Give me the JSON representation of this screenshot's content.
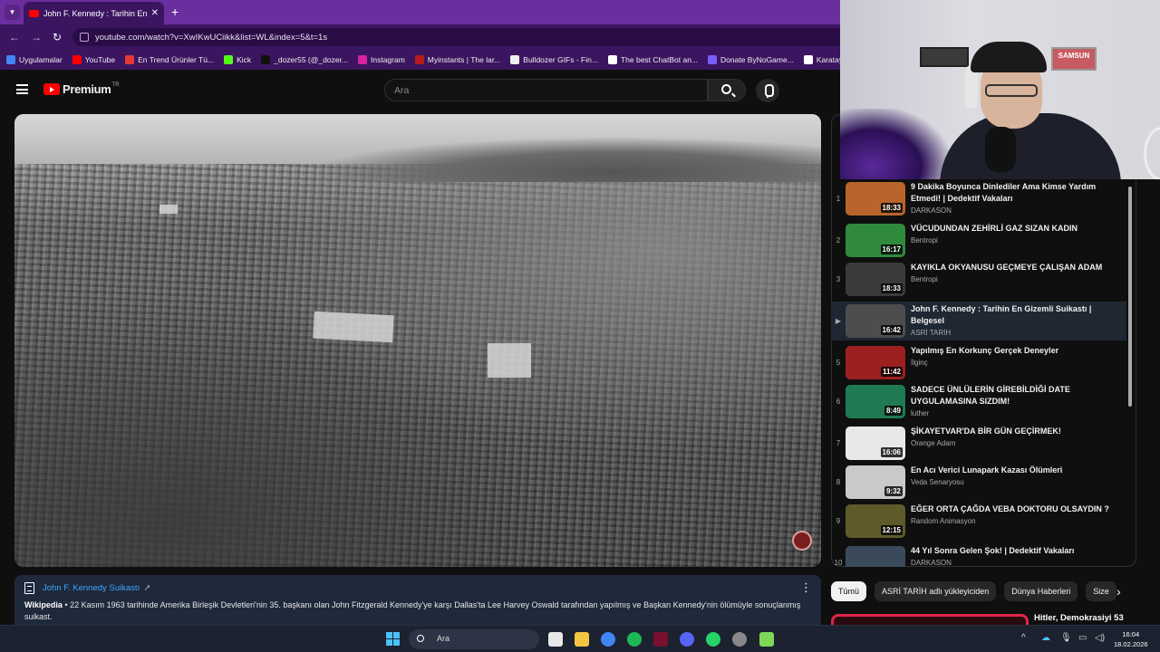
{
  "browser": {
    "tab_title": "John F. Kennedy : Tarihin En Gizemli",
    "tab_close": "✕",
    "new_tab": "+",
    "url": "youtube.com/watch?v=XwIKwUCiikk&list=WL&index=5&t=1s",
    "bookmarks": [
      {
        "label": "Uygulamalar",
        "color": "#4285f4"
      },
      {
        "label": "YouTube",
        "color": "#ff0000"
      },
      {
        "label": "En Trend Ürünler Tü...",
        "color": "#e53935"
      },
      {
        "label": "Kick",
        "color": "#53fc18"
      },
      {
        "label": "_dozer55 (@_dozer...",
        "color": "#111111"
      },
      {
        "label": "Instagram",
        "color": "#d6249f"
      },
      {
        "label": "Myinstants | The lar...",
        "color": "#b71c1c"
      },
      {
        "label": "Bulldozer GIFs - Fin...",
        "color": "#eeeeee"
      },
      {
        "label": "The best ChatBot an...",
        "color": "#ffffff"
      },
      {
        "label": "Donate ByNoGame...",
        "color": "#7b5cff"
      },
      {
        "label": "Karatay Belediyesi",
        "color": "#ffffff"
      }
    ]
  },
  "header": {
    "logo_text": "Premium",
    "region": "TR",
    "search_placeholder": "Ara"
  },
  "info_card": {
    "title": "John F. Kennedy Suikastı",
    "link_icon": "↗",
    "source": "Wikipedia",
    "text": " • 22 Kasım 1963 tarihinde Amerika Birleşik Devletleri'nin 35. başkanı olan John Fitzgerald Kennedy'ye karşı Dallas'ta Lee Harvey Oswald tarafından yapılmış ve Başkan Kennedy'nin ölümüyle sonuçlanmış suikast.",
    "more": "⋮"
  },
  "playlist": [
    {
      "index": "1",
      "title": "9 Dakika Boyunca Dinlediler Ama Kimse Yardım Etmedi! | Dedektif Vakaları",
      "channel": "DARKASON",
      "duration": "18:33",
      "thumb": "#b8642a"
    },
    {
      "index": "2",
      "title": "VÜCUDUNDAN ZEHİRLİ GAZ SIZAN KADIN",
      "channel": "Bentropi",
      "duration": "16:17",
      "thumb": "#2f8a3c"
    },
    {
      "index": "3",
      "title": "KAYIKLA OKYANUSU GEÇMEYE ÇALIŞAN ADAM",
      "channel": "Bentropi",
      "duration": "18:33",
      "thumb": "#3a3a3a"
    },
    {
      "index": "▶",
      "title": "John F. Kennedy : Tarihin En Gizemli Suikastı | Belgesel",
      "channel": "ASRİ TARİH",
      "duration": "16:42",
      "thumb": "#4d4d4d",
      "active": true
    },
    {
      "index": "5",
      "title": "Yapılmış En Korkunç Gerçek Deneyler",
      "channel": "İlginç",
      "duration": "11:42",
      "thumb": "#9c2020"
    },
    {
      "index": "6",
      "title": "SADECE ÜNLÜLERİN GİREBİLDİĞİ DATE UYGULAMASINA SIZDIM!",
      "channel": "luther",
      "duration": "8:49",
      "thumb": "#1f7a52"
    },
    {
      "index": "7",
      "title": "ŞİKAYETVAR'DA BİR GÜN GEÇİRMEK!",
      "channel": "Orange Adam",
      "duration": "16:06",
      "thumb": "#e8e8e8"
    },
    {
      "index": "8",
      "title": "En Acı Verici Lunapark Kazası Ölümleri",
      "channel": "Veda Senaryosu",
      "duration": "9:32",
      "thumb": "#c9c9c9"
    },
    {
      "index": "9",
      "title": "EĞER ORTA ÇAĞDA VEBA DOKTORU OLSAYDIN ?",
      "channel": "Random Animasyon",
      "duration": "12:15",
      "thumb": "#5e5a2a"
    },
    {
      "index": "10",
      "title": "44 Yıl Sonra Gelen Şok! | Dedektif Vakaları",
      "channel": "DARKASON",
      "duration": "",
      "thumb": "#3a4a5a"
    }
  ],
  "chips": [
    "Tümü",
    "ASRİ TARİH adlı yükleyiciden",
    "Dünya Haberleri",
    "Size"
  ],
  "next_video_title": "Hitler, Demokrasiyi 53",
  "webcam": {
    "sign": "SAMSUN"
  },
  "taskbar": {
    "search": "Ara",
    "time": "16:04",
    "date": "18.02.2026"
  }
}
